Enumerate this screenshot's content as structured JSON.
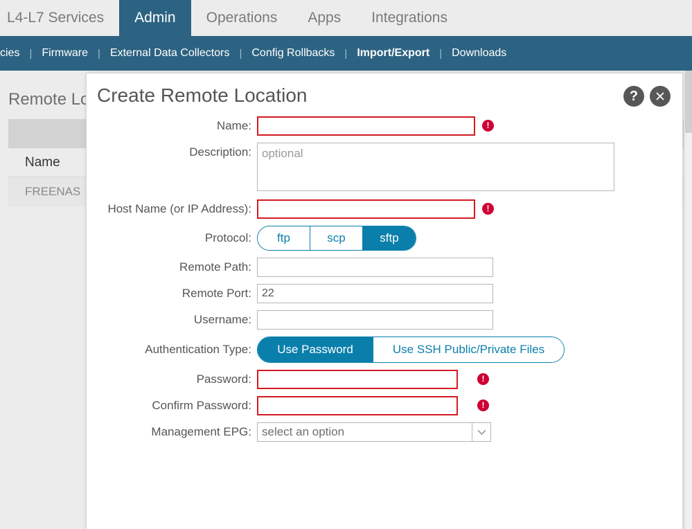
{
  "topnav": {
    "tabs": [
      {
        "label": "L4-L7 Services",
        "active": false
      },
      {
        "label": "Admin",
        "active": true
      },
      {
        "label": "Operations",
        "active": false
      },
      {
        "label": "Apps",
        "active": false
      },
      {
        "label": "Integrations",
        "active": false
      }
    ]
  },
  "subnav": {
    "items": [
      {
        "label": "cies",
        "bold": false
      },
      {
        "label": "Firmware",
        "bold": false
      },
      {
        "label": "External Data Collectors",
        "bold": false
      },
      {
        "label": "Config Rollbacks",
        "bold": false
      },
      {
        "label": "Import/Export",
        "bold": true
      },
      {
        "label": "Downloads",
        "bold": false
      }
    ],
    "separator": "|"
  },
  "background": {
    "page_title": "Remote Lo",
    "table": {
      "columns": [
        "Name"
      ],
      "rows": [
        [
          "FREENAS"
        ]
      ]
    }
  },
  "dialog": {
    "title": "Create Remote Location",
    "help_label": "?",
    "close_label": "✕",
    "fields": {
      "name": {
        "label": "Name:",
        "value": "",
        "placeholder": "",
        "error": true
      },
      "description": {
        "label": "Description:",
        "value": "",
        "placeholder": "optional",
        "error": false
      },
      "host": {
        "label": "Host Name (or IP Address):",
        "value": "",
        "placeholder": "",
        "error": true
      },
      "protocol": {
        "label": "Protocol:",
        "options": [
          "ftp",
          "scp",
          "sftp"
        ],
        "selected": "sftp"
      },
      "remote_path": {
        "label": "Remote Path:",
        "value": "",
        "placeholder": "",
        "error": false
      },
      "remote_port": {
        "label": "Remote Port:",
        "value": "22",
        "placeholder": "",
        "error": false
      },
      "username": {
        "label": "Username:",
        "value": "",
        "placeholder": "",
        "error": false
      },
      "auth_type": {
        "label": "Authentication Type:",
        "options": [
          "Use Password",
          "Use SSH Public/Private Files"
        ],
        "selected": "Use Password"
      },
      "password": {
        "label": "Password:",
        "value": "",
        "placeholder": "",
        "error": true
      },
      "confirm_password": {
        "label": "Confirm Password:",
        "value": "",
        "placeholder": "",
        "error": true
      },
      "management_epg": {
        "label": "Management EPG:",
        "selected": "select an option",
        "options": [
          "select an option"
        ]
      }
    },
    "error_marker": "!"
  },
  "colors": {
    "nav_blue": "#2d6382",
    "accent_blue": "#0a7fab",
    "error_red": "#cc0033",
    "error_border": "#d31a21",
    "page_bg": "#ececec"
  }
}
